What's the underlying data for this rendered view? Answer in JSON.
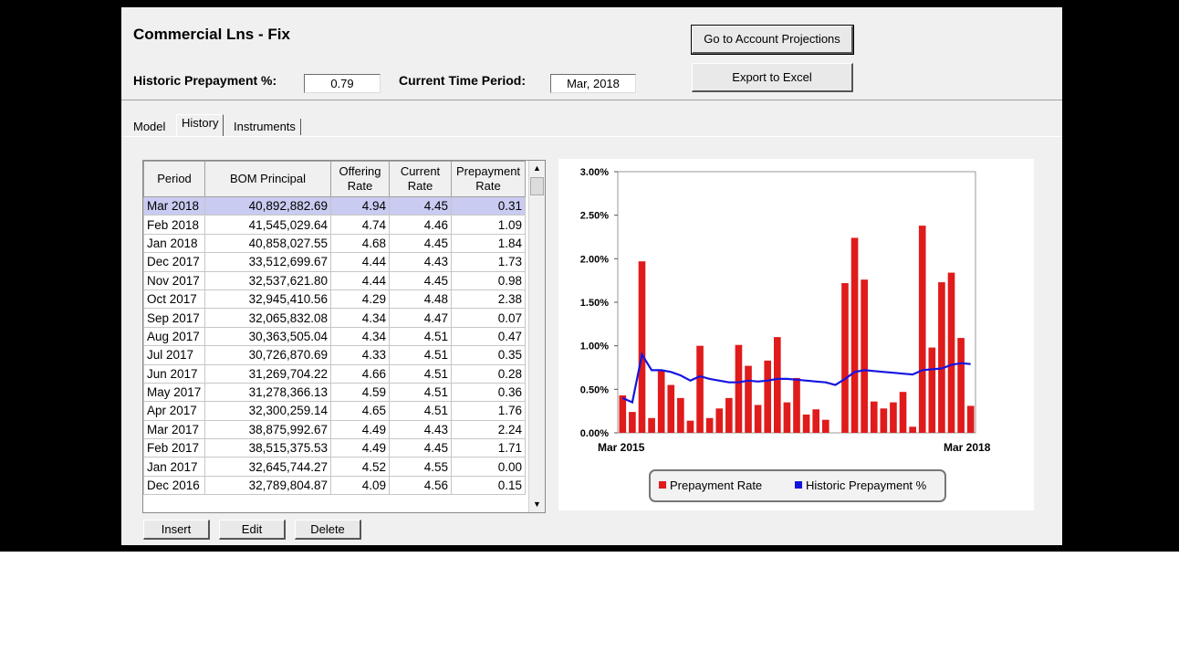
{
  "window": {
    "title": "Commercial Lns - Fix",
    "historic_label": "Historic Prepayment %:",
    "historic_value": "0.79",
    "period_label": "Current Time Period:",
    "period_value": "Mar, 2018",
    "projections_button": "Go to Account Projections",
    "export_button": "Export to Excel"
  },
  "tabs": [
    {
      "label": "Model"
    },
    {
      "label": "History"
    },
    {
      "label": "Instruments"
    }
  ],
  "grid": {
    "headers": {
      "period": "Period",
      "bom": "BOM Principal",
      "offering1": "Offering",
      "offering2": "Rate",
      "current1": "Current",
      "current2": "Rate",
      "prepay1": "Prepayment",
      "prepay2": "Rate"
    },
    "rows": [
      {
        "period": "Mar 2018",
        "bom": "40,892,882.69",
        "offering": "4.94",
        "current": "4.45",
        "prepay": "0.31"
      },
      {
        "period": "Feb 2018",
        "bom": "41,545,029.64",
        "offering": "4.74",
        "current": "4.46",
        "prepay": "1.09"
      },
      {
        "period": "Jan 2018",
        "bom": "40,858,027.55",
        "offering": "4.68",
        "current": "4.45",
        "prepay": "1.84"
      },
      {
        "period": "Dec 2017",
        "bom": "33,512,699.67",
        "offering": "4.44",
        "current": "4.43",
        "prepay": "1.73"
      },
      {
        "period": "Nov 2017",
        "bom": "32,537,621.80",
        "offering": "4.44",
        "current": "4.45",
        "prepay": "0.98"
      },
      {
        "period": "Oct 2017",
        "bom": "32,945,410.56",
        "offering": "4.29",
        "current": "4.48",
        "prepay": "2.38"
      },
      {
        "period": "Sep 2017",
        "bom": "32,065,832.08",
        "offering": "4.34",
        "current": "4.47",
        "prepay": "0.07"
      },
      {
        "period": "Aug 2017",
        "bom": "30,363,505.04",
        "offering": "4.34",
        "current": "4.51",
        "prepay": "0.47"
      },
      {
        "period": "Jul 2017",
        "bom": "30,726,870.69",
        "offering": "4.33",
        "current": "4.51",
        "prepay": "0.35"
      },
      {
        "period": "Jun 2017",
        "bom": "31,269,704.22",
        "offering": "4.66",
        "current": "4.51",
        "prepay": "0.28"
      },
      {
        "period": "May 2017",
        "bom": "31,278,366.13",
        "offering": "4.59",
        "current": "4.51",
        "prepay": "0.36"
      },
      {
        "period": "Apr 2017",
        "bom": "32,300,259.14",
        "offering": "4.65",
        "current": "4.51",
        "prepay": "1.76"
      },
      {
        "period": "Mar 2017",
        "bom": "38,875,992.67",
        "offering": "4.49",
        "current": "4.43",
        "prepay": "2.24"
      },
      {
        "period": "Feb 2017",
        "bom": "38,515,375.53",
        "offering": "4.49",
        "current": "4.45",
        "prepay": "1.71"
      },
      {
        "period": "Jan 2017",
        "bom": "32,645,744.27",
        "offering": "4.52",
        "current": "4.55",
        "prepay": "0.00"
      },
      {
        "period": "Dec 2016",
        "bom": "32,789,804.87",
        "offering": "4.09",
        "current": "4.56",
        "prepay": "0.15"
      }
    ],
    "scroll_up_icon": "triangle-up",
    "scroll_down_icon": "triangle-down"
  },
  "actions": {
    "insert": "Insert",
    "edit": "Edit",
    "delete": "Delete"
  },
  "chart_data": {
    "type": "bar",
    "y_tick_labels": [
      "0.00%",
      "0.50%",
      "1.00%",
      "1.50%",
      "2.00%",
      "2.50%",
      "3.00%"
    ],
    "ylim": [
      0,
      3
    ],
    "x_start_label": "Mar 2015",
    "x_end_label": "Mar 2018",
    "series": [
      {
        "name": "Prepayment Rate",
        "kind": "bar",
        "color": "#e01b1b",
        "values": [
          0.43,
          0.24,
          1.97,
          0.17,
          0.71,
          0.55,
          0.4,
          0.14,
          1.0,
          0.17,
          0.28,
          0.4,
          1.01,
          0.77,
          0.32,
          0.83,
          1.1,
          0.35,
          0.63,
          0.21,
          0.27,
          0.15,
          0.0,
          1.72,
          2.24,
          1.76,
          0.36,
          0.28,
          0.35,
          0.47,
          0.07,
          2.38,
          0.98,
          1.73,
          1.84,
          1.09,
          0.31
        ]
      },
      {
        "name": "Historic Prepayment %",
        "kind": "line",
        "color": "#1414e0",
        "values": [
          0.4,
          0.35,
          0.9,
          0.72,
          0.72,
          0.7,
          0.66,
          0.6,
          0.65,
          0.62,
          0.6,
          0.58,
          0.58,
          0.6,
          0.59,
          0.6,
          0.62,
          0.62,
          0.61,
          0.6,
          0.59,
          0.58,
          0.55,
          0.62,
          0.7,
          0.72,
          0.71,
          0.7,
          0.69,
          0.68,
          0.67,
          0.72,
          0.73,
          0.74,
          0.78,
          0.8,
          0.79
        ]
      }
    ],
    "legend_position": "bottom",
    "grid": false
  }
}
